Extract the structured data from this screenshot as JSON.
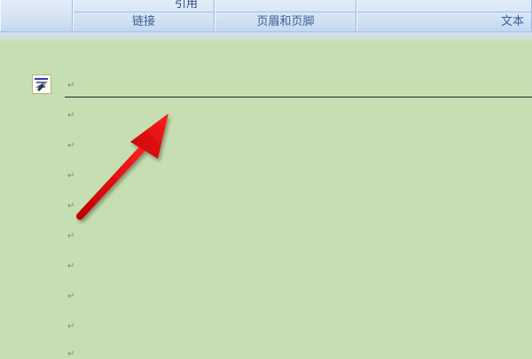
{
  "ribbon": {
    "groups": [
      {
        "name": "links",
        "label": "链接",
        "upper_label": "引用"
      },
      {
        "name": "header-footer",
        "label": "页眉和页脚"
      },
      {
        "name": "text",
        "label": "文本"
      }
    ]
  },
  "document": {
    "paragraph_mark": "↵",
    "header_icon": "header-editing-icon",
    "annotation": "red-arrow-pointing-to-header-line"
  },
  "colors": {
    "page_background": "#c6dfb2",
    "ribbon_label": "#3a5e92",
    "arrow": "#e01010"
  }
}
